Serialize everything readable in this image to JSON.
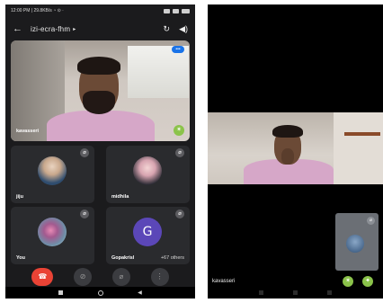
{
  "left": {
    "status": {
      "left_text": "12:00 PM | 29.8KB/s ◔ ⊙ ·"
    },
    "meeting": {
      "back_glyph": "←",
      "name": "izi-ecra-fhm",
      "caret": "▸",
      "switch_camera_glyph": "↻",
      "audio_glyph": "◀)"
    },
    "main_tile": {
      "label": "kavasseri",
      "speaker_badge": "•••",
      "pin_glyph": "✶"
    },
    "participants": [
      {
        "name": "jiju",
        "muted": true
      },
      {
        "name": "midhila",
        "muted": true
      },
      {
        "name": "You",
        "muted": true
      },
      {
        "name": "Gopakrisl",
        "avatar_letter": "G",
        "others": "+67 others",
        "muted": true
      }
    ],
    "mute_glyph": "⌀",
    "controls": {
      "end_glyph": "☎",
      "camera_glyph": "⊘",
      "mic_glyph": "⌀",
      "more_glyph": "⋮"
    },
    "nav": {
      "back": "◀"
    }
  },
  "right": {
    "label": "kavasseri",
    "pip_mute": "⌀",
    "btn1_glyph": "✶",
    "btn2_glyph": "✦"
  },
  "colors": {
    "end_call": "#ea4335",
    "avatar_g": "#5b47b8",
    "accent_green": "#8bc34a",
    "badge_blue": "#1a73e8"
  }
}
